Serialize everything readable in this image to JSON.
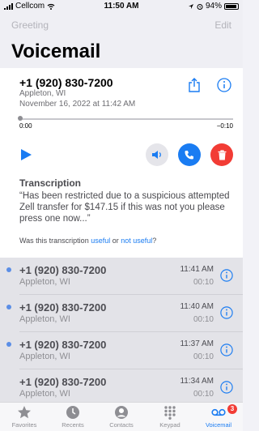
{
  "status": {
    "carrier": "Cellcom",
    "time": "11:50 AM",
    "battery": "94%"
  },
  "nav": {
    "left": "Greeting",
    "right": "Edit"
  },
  "title": "Voicemail",
  "detail": {
    "number": "+1 (920) 830-7200",
    "place": "Appleton, WI",
    "date": "November 16, 2022 at 11:42 AM",
    "time_start": "0:00",
    "time_end": "−0:10",
    "transcription_heading": "Transcription",
    "transcription_text": "“Has been restricted due to a suspicious attempted Zell transfer for $147.15 if this was not you please press one now...”",
    "feedback_prefix": "Was this transcription ",
    "feedback_useful": "useful",
    "feedback_or": " or ",
    "feedback_not_useful": "not useful",
    "feedback_suffix": "?"
  },
  "voicemails": [
    {
      "number": "+1 (920) 830-7200",
      "place": "Appleton, WI",
      "time": "11:41 AM",
      "duration": "00:10"
    },
    {
      "number": "+1 (920) 830-7200",
      "place": "Appleton, WI",
      "time": "11:40 AM",
      "duration": "00:10"
    },
    {
      "number": "+1 (920) 830-7200",
      "place": "Appleton, WI",
      "time": "11:37 AM",
      "duration": "00:10"
    },
    {
      "number": "+1 (920) 830-7200",
      "place": "Appleton, WI",
      "time": "11:34 AM",
      "duration": "00:10"
    }
  ],
  "tabs": [
    "Favorites",
    "Recents",
    "Contacts",
    "Keypad",
    "Voicemail"
  ],
  "voicemail_badge": "3",
  "colors": {
    "accent": "#1a7cf2",
    "delete": "#f23c35",
    "unread_dot": "#5b8ee6"
  },
  "icons": [
    "share-icon",
    "info-icon",
    "play-icon",
    "speaker-icon",
    "phone-icon",
    "trash-icon",
    "star-icon",
    "clock-icon",
    "person-icon",
    "keypad-icon",
    "voicemail-icon"
  ]
}
